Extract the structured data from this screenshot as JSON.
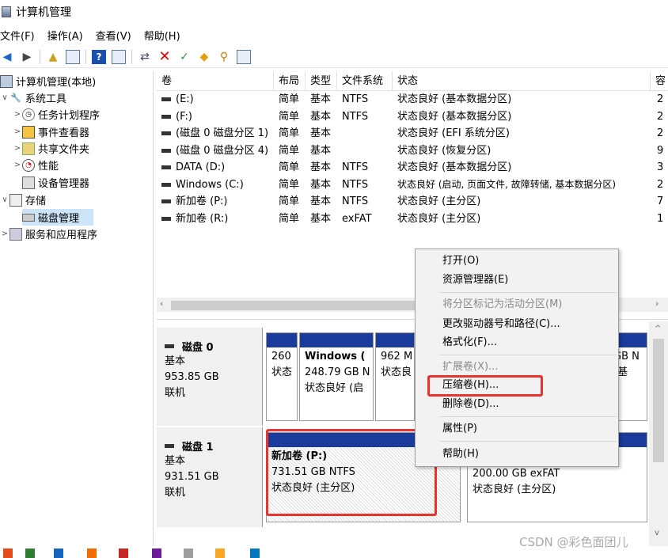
{
  "window": {
    "title": "计算机管理"
  },
  "menu": [
    "文件(F)",
    "操作(A)",
    "查看(V)",
    "帮助(H)"
  ],
  "tree": [
    {
      "label": "计算机管理(本地)",
      "icon": "computer-management-icon",
      "arrow": "∨"
    },
    {
      "label": "系统工具",
      "icon": "system-tools-icon",
      "arrow": "∨"
    },
    {
      "label": "任务计划程序",
      "icon": "task-scheduler-icon",
      "arrow": ">"
    },
    {
      "label": "事件查看器",
      "icon": "event-viewer-icon",
      "arrow": ">"
    },
    {
      "label": "共享文件夹",
      "icon": "shared-folders-icon",
      "arrow": ">"
    },
    {
      "label": "性能",
      "icon": "performance-icon",
      "arrow": ">"
    },
    {
      "label": "设备管理器",
      "icon": "device-manager-icon",
      "arrow": ""
    },
    {
      "label": "存储",
      "icon": "storage-icon",
      "arrow": "∨"
    },
    {
      "label": "磁盘管理",
      "icon": "disk-management-icon",
      "arrow": "",
      "selected": true
    },
    {
      "label": "服务和应用程序",
      "icon": "services-icon",
      "arrow": ">"
    }
  ],
  "volume_table": {
    "headers": [
      "卷",
      "布局",
      "类型",
      "文件系统",
      "状态",
      "容"
    ],
    "rows": [
      {
        "vol": "(E:)",
        "layout": "简单",
        "type": "基本",
        "fs": "NTFS",
        "status": "状态良好 (基本数据分区)",
        "cap": "2"
      },
      {
        "vol": "(F:)",
        "layout": "简单",
        "type": "基本",
        "fs": "NTFS",
        "status": "状态良好 (基本数据分区)",
        "cap": "2"
      },
      {
        "vol": "(磁盘 0 磁盘分区 1)",
        "layout": "简单",
        "type": "基本",
        "fs": "",
        "status": "状态良好 (EFI 系统分区)",
        "cap": "2"
      },
      {
        "vol": "(磁盘 0 磁盘分区 4)",
        "layout": "简单",
        "type": "基本",
        "fs": "",
        "status": "状态良好 (恢复分区)",
        "cap": "9"
      },
      {
        "vol": "DATA (D:)",
        "layout": "简单",
        "type": "基本",
        "fs": "NTFS",
        "status": "状态良好 (基本数据分区)",
        "cap": "3"
      },
      {
        "vol": "Windows (C:)",
        "layout": "简单",
        "type": "基本",
        "fs": "NTFS",
        "status": "状态良好 (启动, 页面文件, 故障转储, 基本数据分区)",
        "cap": "2"
      },
      {
        "vol": "新加卷 (P:)",
        "layout": "简单",
        "type": "基本",
        "fs": "NTFS",
        "status": "状态良好 (主分区)",
        "cap": "7"
      },
      {
        "vol": "新加卷 (R:)",
        "layout": "简单",
        "type": "基本",
        "fs": "exFAT",
        "status": "状态良好 (主分区)",
        "cap": "1"
      }
    ]
  },
  "disks": [
    {
      "name": "磁盘 0",
      "type": "基本",
      "size": "953.85 GB",
      "state": "联机",
      "partitions": [
        {
          "l1": "260",
          "l2": "状态"
        },
        {
          "l1": "Windows (",
          "l2": "248.79 GB N",
          "l3": "状态良好 (启"
        },
        {
          "l1": "962 M",
          "l2": "状态良"
        },
        {
          "l1": "GB N",
          "l2": "(基"
        }
      ]
    },
    {
      "name": "磁盘 1",
      "type": "基本",
      "size": "931.51 GB",
      "state": "联机",
      "partitions": [
        {
          "l1": "新加卷 (P:)",
          "l2": "731.51 GB NTFS",
          "l3": "状态良好 (主分区)"
        },
        {
          "l1": "200.00 GB exFAT",
          "l2": "状态良好 (主分区)"
        }
      ]
    }
  ],
  "context_menu": [
    {
      "label": "打开(O)",
      "enabled": true
    },
    {
      "label": "资源管理器(E)",
      "enabled": true
    },
    {
      "label": "将分区标记为活动分区(M)",
      "enabled": false
    },
    {
      "label": "更改驱动器号和路径(C)...",
      "enabled": true
    },
    {
      "label": "格式化(F)...",
      "enabled": true
    },
    {
      "label": "扩展卷(X)...",
      "enabled": false
    },
    {
      "label": "压缩卷(H)...",
      "enabled": true
    },
    {
      "label": "删除卷(D)...",
      "enabled": true
    },
    {
      "label": "属性(P)",
      "enabled": true
    },
    {
      "label": "帮助(H)",
      "enabled": true
    }
  ],
  "highlight_color": "#e8332f",
  "partition_bar_color": "#1a3a9c",
  "watermark": "CSDN @彩色面团儿"
}
